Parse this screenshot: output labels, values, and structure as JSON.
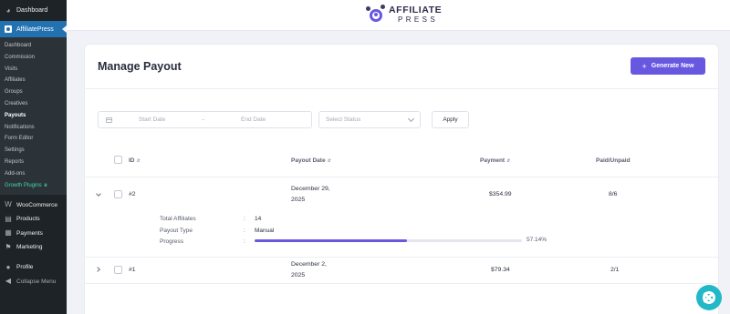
{
  "sidebar": {
    "dashboard_top": "Dashboard",
    "active_plugin": "AffiliatePress",
    "submenu": [
      {
        "label": "Dashboard"
      },
      {
        "label": "Commission"
      },
      {
        "label": "Visits"
      },
      {
        "label": "Affiliates"
      },
      {
        "label": "Groups"
      },
      {
        "label": "Creatives"
      },
      {
        "label": "Payouts",
        "current": true
      },
      {
        "label": "Notifications"
      },
      {
        "label": "Form Editor"
      },
      {
        "label": "Settings"
      },
      {
        "label": "Reports"
      },
      {
        "label": "Add-ons"
      },
      {
        "label": "Growth Plugins",
        "icon": "crown-icon"
      }
    ],
    "items": [
      {
        "label": "WooCommerce",
        "icon": "woocommerce-icon"
      },
      {
        "label": "Products",
        "icon": "products-icon"
      },
      {
        "label": "Payments",
        "icon": "payments-icon"
      },
      {
        "label": "Marketing",
        "icon": "marketing-icon"
      },
      {
        "label": "Profile",
        "icon": "profile-icon"
      },
      {
        "label": "Collapse Menu",
        "icon": "collapse-icon"
      }
    ]
  },
  "header": {
    "brand_line1": "AFFILIATE",
    "brand_line2": "PRESS"
  },
  "page": {
    "title": "Manage Payout",
    "generate_button": "Generate New"
  },
  "filters": {
    "start_date_placeholder": "Start Date",
    "date_separator": "–",
    "end_date_placeholder": "End Date",
    "status_placeholder": "Select Status",
    "apply_label": "Apply"
  },
  "table": {
    "headers": {
      "id": "ID",
      "payout_date": "Payout Date",
      "payment": "Payment",
      "paid_unpaid": "Paid/Unpaid"
    },
    "rows": [
      {
        "id": "#2",
        "date_line1": "December 29,",
        "date_line2": "2025",
        "payment": "$354.99",
        "paid_unpaid": "8/6",
        "expanded": true,
        "details": {
          "total_affiliates_label": "Total Affiliates",
          "total_affiliates": "14",
          "payout_type_label": "Payout Type",
          "payout_type": "Manual",
          "progress_label": "Progress",
          "progress_percent": 57.14,
          "progress_text": "57.14%",
          "colon": ":"
        }
      },
      {
        "id": "#1",
        "date_line1": "December 2,",
        "date_line2": "2025",
        "payment": "$79.34",
        "paid_unpaid": "2/1",
        "expanded": false
      }
    ]
  },
  "colors": {
    "accent": "#6858e0",
    "wp_sidebar": "#1d2327",
    "wp_active": "#2271b1",
    "growth": "#3fd8a6",
    "help_fab": "#22b8c8"
  }
}
